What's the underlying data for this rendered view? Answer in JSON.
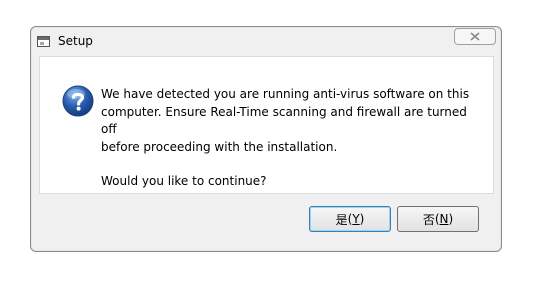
{
  "window": {
    "title": "Setup"
  },
  "message": {
    "icon": "question-icon",
    "lines": [
      "We have detected you are running anti-virus software on this",
      "computer. Ensure Real-Time scanning and firewall are turned off",
      "before proceeding with the installation."
    ],
    "question": "Would you like to continue?"
  },
  "buttons": {
    "yes": {
      "label": "是",
      "mnemonic": "Y"
    },
    "no": {
      "label": "否",
      "mnemonic": "N"
    }
  },
  "colors": {
    "question_icon_blue": "#2a5db0",
    "default_button_border": "#3c7fb1"
  }
}
